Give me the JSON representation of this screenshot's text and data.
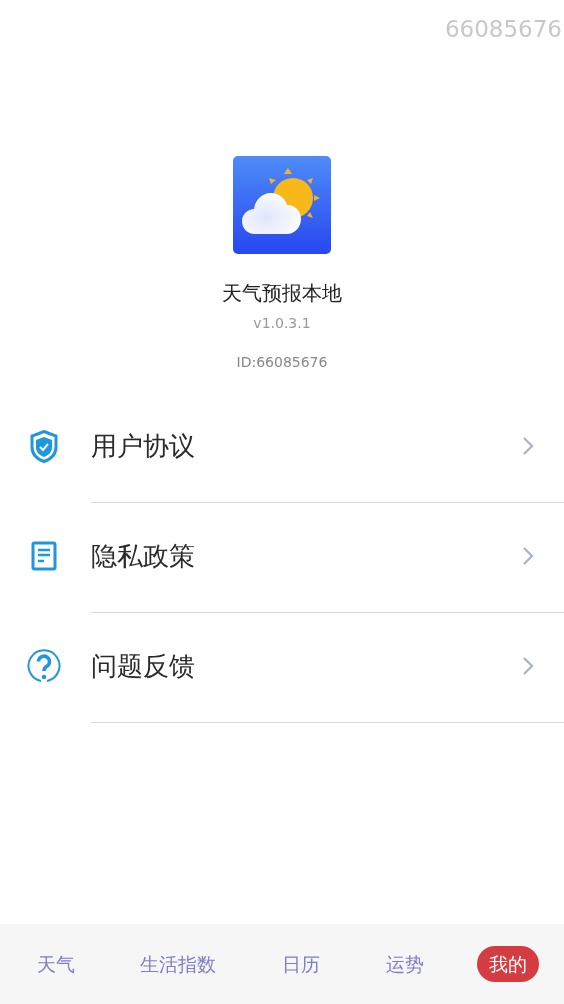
{
  "corner_id": "66085676",
  "app": {
    "name": "天气预报本地",
    "version": "v1.0.3.1",
    "id_label": "ID:66085676"
  },
  "menu": [
    {
      "kind": "shield",
      "label": "用户协议"
    },
    {
      "kind": "document",
      "label": "隐私政策"
    },
    {
      "kind": "question",
      "label": "问题反馈"
    }
  ],
  "tabs": [
    {
      "label": "天气",
      "selected": false
    },
    {
      "label": "生活指数",
      "selected": false
    },
    {
      "label": "日历",
      "selected": false
    },
    {
      "label": "运势",
      "selected": false
    },
    {
      "label": "我的",
      "selected": true
    }
  ]
}
